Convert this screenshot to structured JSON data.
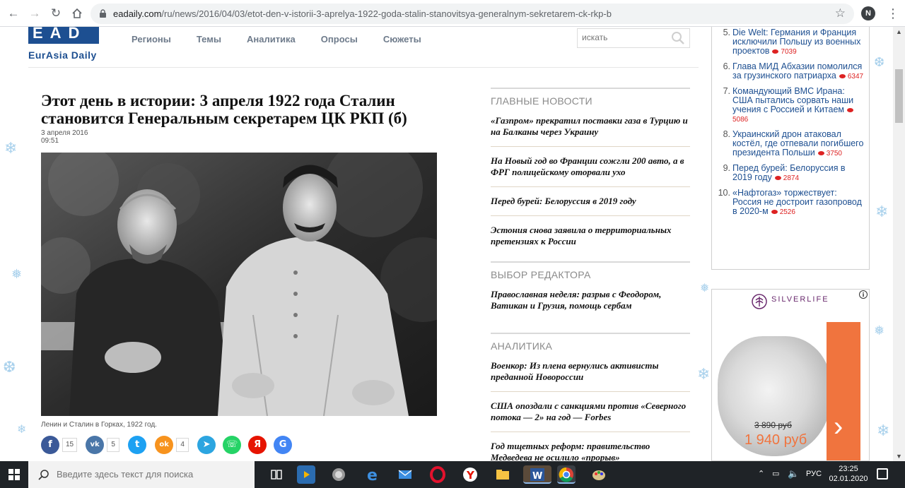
{
  "browser": {
    "url_host": "eadaily.com",
    "url_path": "/ru/news/2016/04/03/etot-den-v-istorii-3-aprelya-1922-goda-stalin-stanovitsya-generalnym-sekretarem-ck-rkp-b",
    "profile_initial": "N"
  },
  "site": {
    "logo_letters": "EAD",
    "logo_text": "EurAsia Daily",
    "nav": [
      "Регионы",
      "Темы",
      "Аналитика",
      "Опросы",
      "Сюжеты"
    ],
    "search_placeholder": "искать"
  },
  "article": {
    "title": "Этот день в истории: 3 апреля 1922 года Сталин становится Генеральным секретарем ЦК РКП (б)",
    "date": "3 апреля 2016",
    "time": "09:51",
    "photo_caption": "Ленин и Сталин в Горках, 1922 год."
  },
  "share": [
    {
      "name": "facebook",
      "glyph": "f",
      "color": "#3b5998",
      "count": "15"
    },
    {
      "name": "vk",
      "glyph": "vk",
      "color": "#4a76a8",
      "count": "5"
    },
    {
      "name": "twitter",
      "glyph": "t",
      "color": "#1da1f2",
      "count": ""
    },
    {
      "name": "odnoklassniki",
      "glyph": "ok",
      "color": "#f7931e",
      "count": "4"
    },
    {
      "name": "telegram",
      "glyph": "➤",
      "color": "#2ca5e0",
      "count": ""
    },
    {
      "name": "whatsapp",
      "glyph": "☏",
      "color": "#25d366",
      "count": ""
    },
    {
      "name": "yandex",
      "glyph": "Я",
      "color": "#e61400",
      "count": ""
    },
    {
      "name": "google",
      "glyph": "G",
      "color": "#4285f4",
      "count": ""
    }
  ],
  "sections": [
    {
      "title": "ГЛАВНЫЕ НОВОСТИ",
      "items": [
        "«Газпром» прекратил поставки газа в Турцию и на Балканы через Украину",
        "На Новый год во Франции сожгли 200 авто, а в ФРГ полицейскому оторвали ухо",
        "Перед бурей: Белоруссия в 2019 году",
        "Эстония снова заявила о территориальных претензиях к России"
      ]
    },
    {
      "title": "ВЫБОР РЕДАКТОРА",
      "items": [
        "Православная неделя: разрыв с Феодором, Ватикан и Грузия, помощь сербам"
      ]
    },
    {
      "title": "АНАЛИТИКА",
      "items": [
        "Военкор: Из плена вернулись активисты преданной Новороссии",
        "США опоздали с санкциями против «Северного потока — 2» на год — Forbes",
        "Год тщетных реформ: правительство Медведева не осилило «прорыв»"
      ]
    }
  ],
  "top_list": [
    {
      "num": "5.",
      "text": "Die Welt: Германия и Франция исключили Польшу из военных проектов",
      "views": "7039"
    },
    {
      "num": "6.",
      "text": "Глава МИД Абхазии помолился за грузинского патриарха",
      "views": "6347"
    },
    {
      "num": "7.",
      "text": "Командующий ВМС Ирана: США пытались сорвать наши учения с Россией и Китаем",
      "views": "5086"
    },
    {
      "num": "8.",
      "text": "Украинский дрон атаковал костёл, где отпевали погибшего президента Польши",
      "views": "3750"
    },
    {
      "num": "9.",
      "text": "Перед бурей: Белоруссия в 2019 году",
      "views": "2874"
    },
    {
      "num": "10.",
      "text": "«Нафтогаз» торжествует: Россия не достроит газопровод в 2020-м",
      "views": "2526"
    }
  ],
  "ad": {
    "brand": "SILVERLIFE",
    "old_price": "3 890 руб",
    "new_price": "1 940 руб",
    "info": "i"
  },
  "taskbar": {
    "search_placeholder": "Введите здесь текст для поиска",
    "lang": "РУС",
    "time": "23:25",
    "date": "02.01.2020"
  }
}
